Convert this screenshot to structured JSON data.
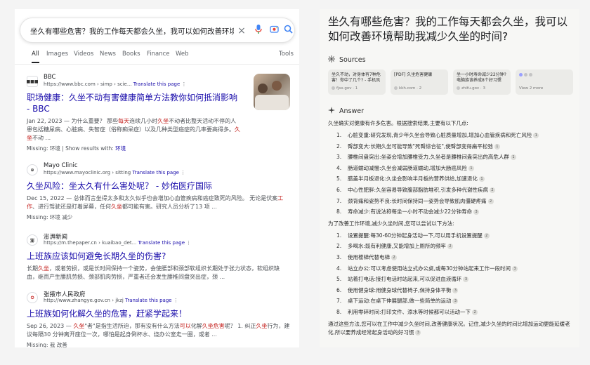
{
  "search": {
    "query": "坐久有哪些危害？我的工作每天都会久坐，我可以如何改善环境帮助我"
  },
  "tabs": [
    "All",
    "Images",
    "Videos",
    "News",
    "Books",
    "Finance",
    "Web"
  ],
  "tools_label": "Tools",
  "results": [
    {
      "source": "BBC",
      "url": "https://www.bbc.com › simp › scie...",
      "translate": "Translate this page",
      "title": "职场健康：久坐不动有害健康简单方法教你如何抵消影响 - BBC",
      "snippet_parts": [
        "Jan 22, 2023 — 为什么重要？ 那些",
        "每天",
        "连续几小时",
        "久坐",
        "不动者比整天活动不停的人患包括糖尿病、心脏病、失智症（俗称痴呆症）以及几种类型癌症的几率要高得多。",
        "久坐",
        "不动 ..."
      ],
      "missing": "Missing: 环境 | Show results with:",
      "missing_link": "环境"
    },
    {
      "source": "Mayo Clinic",
      "url": "https://www.mayoclinic.org › sitting",
      "translate": "Translate this page",
      "title": "久坐风险：坐太久有什么害处呢？ - 妙佑医疗国际",
      "snippet_parts": [
        "Dec 15, 2022 — 总体而言坐得太多和太久似乎也会增加心血管疾病和癌症致死的风险。 无论是伏案",
        "工作",
        "、进行驾驶还是盯着屏幕，任何",
        "久坐",
        "都可能有害。研究人员分析了13 项 ..."
      ],
      "missing": "Missing: 环境 减少"
    },
    {
      "source": "澎湃新闻",
      "url": "https://m.thepaper.cn › kuaibao_det...",
      "translate": "Translate this page",
      "title": "上班族应该如何避免长期久坐的伤害?",
      "snippet_parts": [
        "长期",
        "久坐",
        "，或者劳损，或是长时间保持一个姿势，会使腰部和颈部软组织长期处于张力状态，软组织缺血，继而产生腰肌劳损、颈部肌肉劳损，严重者还会发生腰椎间盘突出症，颈 ..."
      ]
    },
    {
      "source": "张掖市人民政府",
      "url": "http://www.zhangye.gov.cn › jkzj",
      "translate": "Translate this page",
      "title": "上班族如何化解久坐的危害，赶紧学起来！",
      "snippet_parts": [
        "Sep 26, 2023 — ",
        "久坐",
        "\"者\"是指生活所迫，那有没有什么方法",
        "可以",
        "化解",
        "久坐危害",
        "呢？ 1. 纠正",
        "久坐",
        "行为，建议每隔30 分钟离开座位一次，哪怕是起身倒杯水、绕办公室走一圈，或者 ..."
      ],
      "missing": "Missing: 我 改善"
    }
  ],
  "answer_panel": {
    "title": "坐久有哪些危害？我的工作每天都会久坐，我可以如何改善环境帮助我减少久坐的时间?",
    "sources_heading": "Sources",
    "sources": [
      {
        "text": "坐久不动，对身体有7种危害！你中了几个? - 手机凤凰网",
        "site": "fjsx.gov",
        "n": "1"
      },
      {
        "text": "[PDF] 久坐危害健康",
        "site": "kkh.com",
        "n": "2"
      },
      {
        "text": "坐一小时寿命减少22分钟? 电脑族该养成8个好习惯",
        "site": "zhifu.gov",
        "n": "3"
      }
    ],
    "view_more": "View 2 more",
    "answer_heading": "Answer",
    "intro": "久坐确实对健康有许多危害。根据搜索结果,主要有以下几点:",
    "harms": [
      {
        "n": "1.",
        "t": "心脏变重:研究发现,青少年久坐会导致心脏质量增加,增加心血管疾病和死亡风险",
        "c": "1"
      },
      {
        "n": "2.",
        "t": "臀部变大:长期久坐可能导致\"死臀综合征\",使臀部变得扁平松弛",
        "c": "1"
      },
      {
        "n": "3.",
        "t": "腰椎间盘突出:坐姿会增加腰椎受力,久坐者是腰椎间盘突出的高危人群",
        "c": "1"
      },
      {
        "n": "4.",
        "t": "肠道蠕动减慢:久坐会减弱肠道蠕动,增加大肠癌风险",
        "c": "1"
      },
      {
        "n": "5.",
        "t": "腊盖半月板退化:久坐会影响半月板的营养供给,加速退化",
        "c": "1"
      },
      {
        "n": "6.",
        "t": "中心性肥胖:久坐容易导致腹部脂肪堆积,引发多种代谢性疾病",
        "c": "2"
      },
      {
        "n": "7.",
        "t": "颈背痛和姿势不良:长时间保持同一姿势会导致肌肉僵硬疼痛",
        "c": "2"
      },
      {
        "n": "8.",
        "t": "寿命减少:有说法称每坐一小时不动会减少22分钟寿命",
        "c": "3"
      }
    ],
    "tips_intro": "为了改善工作环境,减少久坐时间,您可以尝试以下方法:",
    "tips": [
      {
        "n": "1.",
        "t": "设置提醒:每30-60分钟起身活动一下,可以用手机设置提醒",
        "c": "2"
      },
      {
        "n": "2.",
        "t": "多喝水:既有利健康,又能增加上厕所的频率",
        "c": "2"
      },
      {
        "n": "3.",
        "t": "使用楼梯代替电梯",
        "c": "2"
      },
      {
        "n": "4.",
        "t": "站立办公:可以考虑使用站立式办公桌,或每30分钟站起来工作一段时间",
        "c": "3"
      },
      {
        "n": "5.",
        "t": "站着打电话:接打电话时站起来,可以促进血液循环",
        "c": "3"
      },
      {
        "n": "6.",
        "t": "使用健身球:用健身球代替椅子,保持身体平衡",
        "c": "3"
      },
      {
        "n": "7.",
        "t": "桌下运动:在桌下伸展腿部,做一些简单的运动",
        "c": "3"
      },
      {
        "n": "8.",
        "t": "利用零碎时间:打印文件、添水等时候都可以活动一下",
        "c": "2"
      }
    ],
    "conclusion": "通过这些方法,您可以在工作中减少久坐时间,改善健康状况。记住,减少久坐的时间比增加运动更能延缓老化,所以要养成经常起身活动的好习惯",
    "conclusion_cite": "3"
  },
  "colors": {
    "link": "#1a0dab",
    "emphasis": "#c5221f",
    "panel_bg": "#f7f7f5"
  }
}
